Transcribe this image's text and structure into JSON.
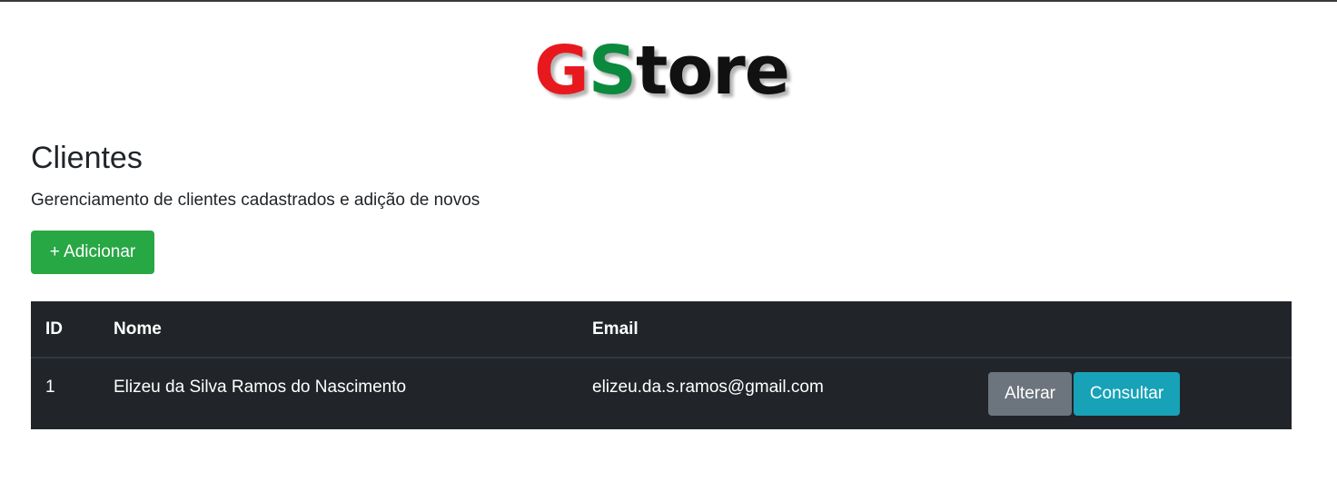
{
  "logo": {
    "letter_g": "G",
    "letter_s": "S",
    "rest": "tore",
    "colors": {
      "g": "#e8191e",
      "s": "#0b8a3e",
      "rest": "#111111"
    }
  },
  "page": {
    "title": "Clientes",
    "subtitle": "Gerenciamento de clientes cadastrados e adição de novos"
  },
  "toolbar": {
    "add_label": "+ Adicionar",
    "add_color": "#28a745"
  },
  "table": {
    "columns": [
      "ID",
      "Nome",
      "Email",
      ""
    ],
    "rows": [
      {
        "id": "1",
        "nome": "Elizeu da Silva Ramos do Nascimento",
        "email": "elizeu.da.s.ramos@gmail.com",
        "actions": {
          "alterar_label": "Alterar",
          "consultar_label": "Consultar"
        }
      }
    ],
    "background": "#212529"
  }
}
